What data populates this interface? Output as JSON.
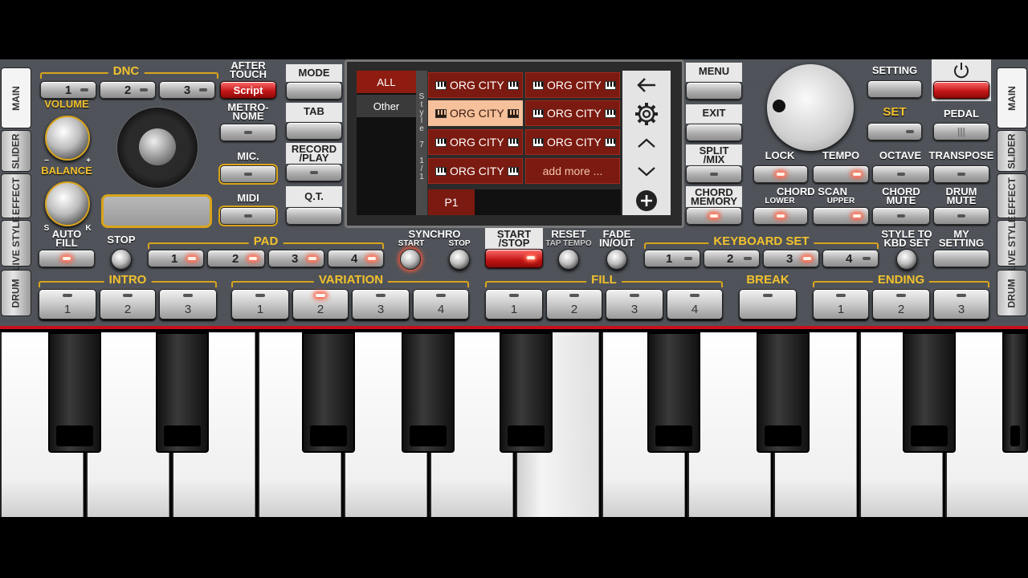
{
  "sidebar_left": [
    "MAIN",
    "SLIDER",
    "EFFECT",
    "LIVE STYLE",
    "DRUM"
  ],
  "sidebar_right": [
    "MAIN",
    "SLIDER",
    "EFFECT",
    "LIVE STYLE",
    "DRUM"
  ],
  "dnc": {
    "title": "DNC",
    "buttons": [
      "1",
      "2",
      "3"
    ],
    "script": "Script"
  },
  "after_touch": "AFTER\nTOUCH",
  "volume": "VOLUME",
  "balance": "BALANCE",
  "balance_s": "S",
  "balance_k": "K",
  "vol_minus": "−",
  "vol_plus": "+",
  "metronome": "METRO-\nNOME",
  "mic": "MIC.",
  "midi": "MIDI",
  "left_col": {
    "mode": "MODE",
    "tab": "TAB",
    "record": "RECORD\n/PLAY",
    "qt": "Q.T."
  },
  "screen": {
    "categories": [
      "ALL",
      "Other"
    ],
    "vertical_text": "S\nt\ny\nl\ne\n\n7\n\n1\n/\n1",
    "styles": [
      "ORG CITY",
      "ORG CITY",
      "ORG CITY",
      "ORG CITY",
      "ORG CITY",
      "ORG CITY",
      "ORG CITY"
    ],
    "add_more": "add more ...",
    "page": "P1"
  },
  "right_col": {
    "menu": "MENU",
    "exit": "EXIT",
    "split": "SPLIT\n/MIX",
    "chord_memory": "CHORD\nMEMORY"
  },
  "setting": "SETTING",
  "set": "SET",
  "pedal": "PEDAL",
  "lock": "LOCK",
  "tempo": "TEMPO",
  "octave": "OCTAVE",
  "transpose": "TRANSPOSE",
  "chord_scan": "CHORD SCAN",
  "lower": "LOWER",
  "upper": "UPPER",
  "chord_mute": "CHORD\nMUTE",
  "drum_mute": "DRUM\nMUTE",
  "auto_fill": "AUTO\nFILL",
  "stop": "STOP",
  "pad": {
    "title": "PAD",
    "buttons": [
      "1",
      "2",
      "3",
      "4"
    ]
  },
  "synchro": {
    "title": "SYNCHRO",
    "start": "START",
    "stop": "STOP"
  },
  "start_stop": "START\n/STOP",
  "reset": "RESET",
  "tap_tempo": "TAP TEMPO",
  "fade": "FADE\nIN/OUT",
  "keyboard_set": {
    "title": "KEYBOARD SET",
    "buttons": [
      "1",
      "2",
      "3",
      "4"
    ]
  },
  "style_to_kbd": "STYLE TO\nKBD SET",
  "my_setting": "MY\nSETTING",
  "intro": {
    "title": "INTRO",
    "buttons": [
      "1",
      "2",
      "3"
    ]
  },
  "variation": {
    "title": "VARIATION",
    "buttons": [
      "1",
      "2",
      "3",
      "4"
    ]
  },
  "fill": {
    "title": "FILL",
    "buttons": [
      "1",
      "2",
      "3",
      "4"
    ]
  },
  "break": {
    "title": "BREAK"
  },
  "ending": {
    "title": "ENDING",
    "buttons": [
      "1",
      "2",
      "3"
    ]
  },
  "colors": {
    "accent": "#f2c12e",
    "led": "#ff5a3c",
    "screen_red": "#7b1a10",
    "keyboard_border": "#c8101a"
  }
}
